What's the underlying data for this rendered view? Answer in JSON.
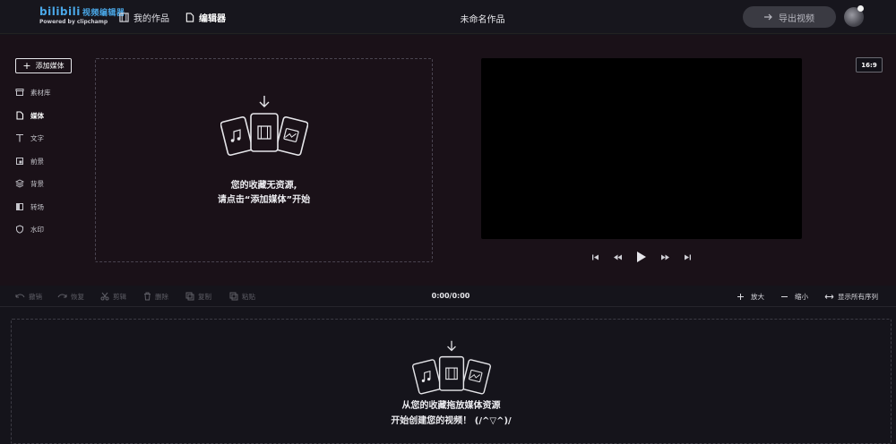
{
  "header": {
    "brand": "bilibili",
    "brand_sub": "视频编辑器",
    "powered_by": "Powered by clipchamp",
    "nav": [
      {
        "label": "我的作品",
        "icon": "film-icon"
      },
      {
        "label": "编辑器",
        "icon": "document-icon"
      }
    ],
    "project_title": "未命名作品",
    "export_label": "导出视频"
  },
  "sidebar": {
    "add_media_label": "添加媒体",
    "items": [
      {
        "label": "素材库",
        "icon": "library-icon",
        "active": false
      },
      {
        "label": "媒体",
        "icon": "document-icon",
        "active": true
      },
      {
        "label": "文字",
        "icon": "text-icon",
        "active": false
      },
      {
        "label": "前景",
        "icon": "foreground-icon",
        "active": false
      },
      {
        "label": "背景",
        "icon": "layers-icon",
        "active": false
      },
      {
        "label": "转场",
        "icon": "transition-icon",
        "active": false
      },
      {
        "label": "水印",
        "icon": "shield-icon",
        "active": false
      }
    ]
  },
  "media_panel": {
    "empty_line1": "您的收藏无资源,",
    "empty_line2": "请点击“添加媒体”开始"
  },
  "preview": {
    "aspect_ratio": "16:9"
  },
  "toolbar": {
    "undo": "撤销",
    "redo": "恢复",
    "cut": "剪辑",
    "delete": "删除",
    "copy": "复制",
    "paste": "粘贴",
    "timecode": "0:00/0:00",
    "zoom_in": "放大",
    "zoom_out": "缩小",
    "show_all": "显示所有序列"
  },
  "timeline": {
    "empty_line1": "从您的收藏拖放媒体资源",
    "empty_line2": "开始创建您的视频！ (/^▽^)/"
  },
  "colors": {
    "accent": "#4aa8e8",
    "workspace_bg": "#1a1118",
    "page_bg": "#15141b"
  }
}
